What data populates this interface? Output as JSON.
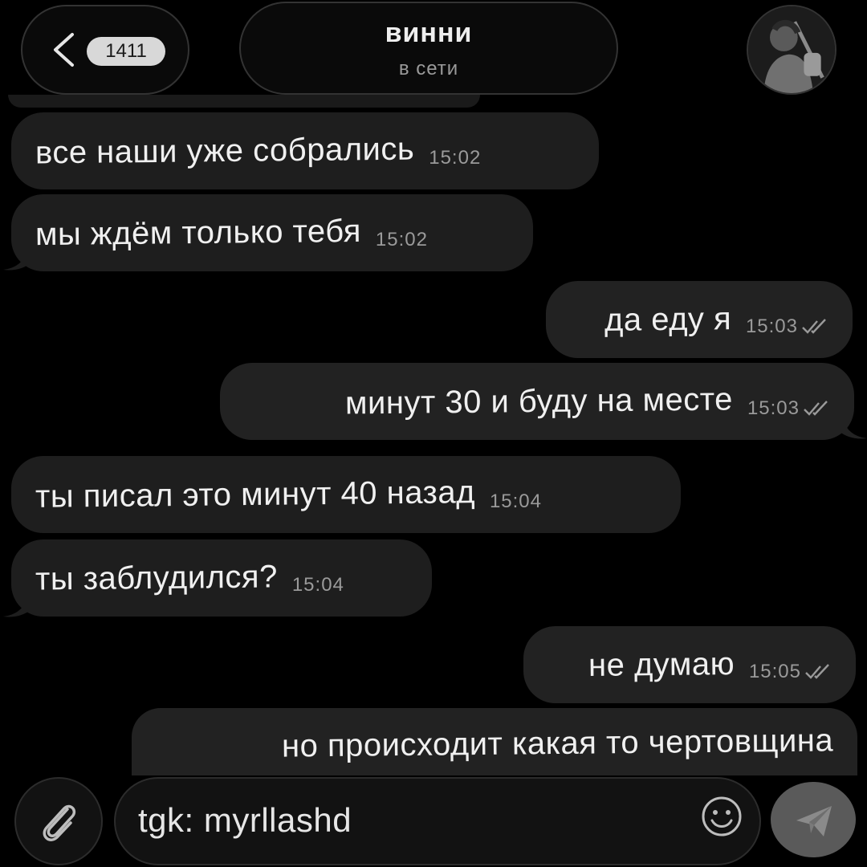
{
  "header": {
    "unread_count": "1411",
    "contact_name": "винни",
    "contact_status": "в сети"
  },
  "messages": [
    {
      "direction": "in",
      "text": "все наши уже собрались",
      "time": "15:02"
    },
    {
      "direction": "in",
      "text": "мы ждём только тебя",
      "time": "15:02"
    },
    {
      "direction": "out",
      "text": "да еду я",
      "time": "15:03",
      "status": "read"
    },
    {
      "direction": "out",
      "text": "минут 30 и буду на месте",
      "time": "15:03",
      "status": "read"
    },
    {
      "direction": "in",
      "text": "ты писал это минут 40 назад",
      "time": "15:04"
    },
    {
      "direction": "in",
      "text": "ты заблудился?",
      "time": "15:04"
    },
    {
      "direction": "out",
      "text": "не думаю",
      "time": "15:05",
      "status": "read"
    },
    {
      "direction": "out",
      "text": "но происходит какая то чертовщина",
      "time": "",
      "status": ""
    }
  ],
  "composer": {
    "input_value": "tgk: myrllashd",
    "attach_icon": "paperclip-icon",
    "emoji_icon": "smiley-icon",
    "send_icon": "paper-plane-icon"
  },
  "theme": {
    "background": "#000000",
    "bubble_in": "#1e1e1e",
    "bubble_out": "#222222",
    "send_button": "#5a5a5a"
  }
}
